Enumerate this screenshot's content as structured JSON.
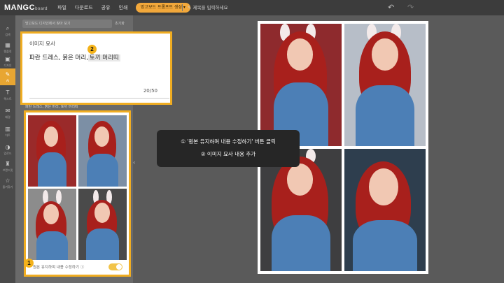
{
  "topbar": {
    "logo": "MANGC",
    "logo_suffix": "board",
    "menu": [
      "파일",
      "다운로드",
      "공유",
      "인쇄"
    ],
    "prompt_pill": "망고보드 프롬프트 생성 ▾",
    "edit_name": "제목을 입력하세요",
    "undo_icon": "↶",
    "redo_icon": "↷"
  },
  "rail": [
    {
      "icon": "⌕",
      "label": "검색"
    },
    {
      "icon": "▦",
      "label": "템플릿"
    },
    {
      "icon": "▣",
      "label": "디자인"
    },
    {
      "icon": "✎",
      "label": "AI"
    },
    {
      "icon": "T",
      "label": "텍스트"
    },
    {
      "icon": "✉",
      "label": "배경"
    },
    {
      "icon": "▥",
      "label": "차트"
    },
    {
      "icon": "◑",
      "label": "업로드"
    },
    {
      "icon": "♜",
      "label": "브랜드킷"
    },
    {
      "icon": "☆",
      "label": "즐겨찾기"
    }
  ],
  "panel": {
    "search_placeholder": "망고보드 디자인에서 찾아 보기",
    "reset": "초기화",
    "desc_row_label": "파란 드레스, 붉은 머리, 토끼 머리띠"
  },
  "description": {
    "title": "이미지 묘사",
    "text": "파란 드레스, 붉은 머리,",
    "added": "토끼 머리띠",
    "count": "20/50"
  },
  "badges": {
    "one": "1",
    "two": "2"
  },
  "keep_original": {
    "label": "원본 유지하며 내용 수정하기 ⓘ"
  },
  "tooltip": {
    "line1": "① '원본 유지하며 내용 수정하기' 버튼 클릭",
    "line2": "② 이미지 묘사 내용 추가"
  },
  "colors": {
    "accent": "#f0ad22",
    "dress": "#4c7fb6",
    "hair": "#a8201c"
  }
}
